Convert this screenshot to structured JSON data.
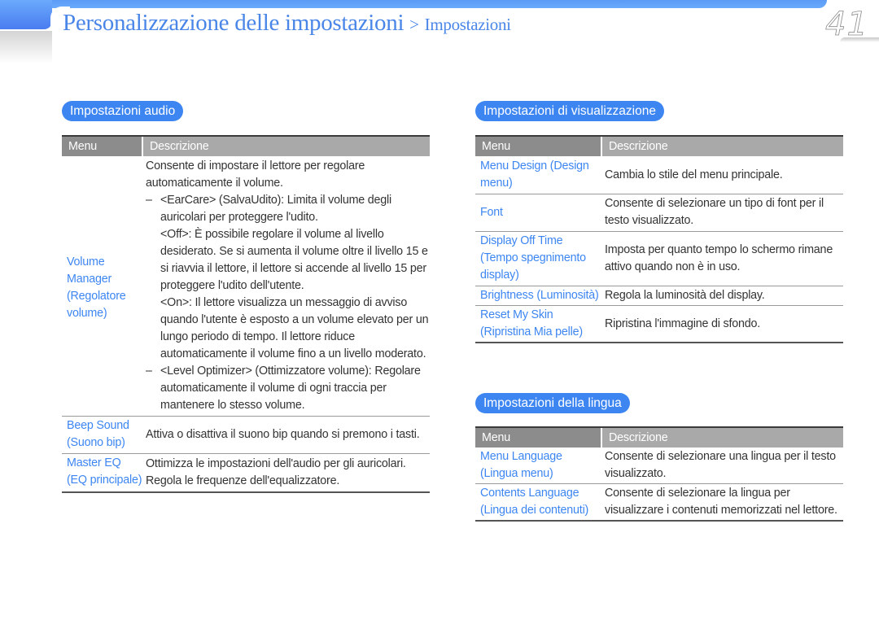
{
  "header": {
    "title_main": "Personalizzazione delle impostazioni",
    "separator": ">",
    "title_sub": "Impostazioni",
    "page_number": "41",
    "accent_color": "#3d86f2"
  },
  "audio": {
    "section_title": "Impostazioni audio",
    "columns": [
      "Menu",
      "Descrizione"
    ],
    "rows": [
      {
        "menu": "Volume Manager (Regolatore volume)",
        "intro": "Consente di impostare il lettore per regolare automaticamente il volume.",
        "dash1_title": "<EarCare> (SalvaUdito): Limita il volume degli auricolari per proteggere l'udito.",
        "dash1_off": "<Off>: È possibile regolare il volume al livello desiderato. Se si aumenta il volume oltre il livello 15 e si riavvia il lettore, il lettore si accende al livello 15 per proteggere l'udito dell'utente.",
        "dash1_on": "<On>: Il lettore visualizza un messaggio di avviso quando l'utente è esposto a un volume elevato per un lungo periodo di tempo. Il lettore riduce automaticamente il volume fino a un livello moderato.",
        "dash2": "<Level Optimizer> (Ottimizzatore volume): Regolare automaticamente il volume di ogni traccia per mantenere lo stesso volume.",
        "dash": "–"
      },
      {
        "menu": "Beep Sound (Suono bip)",
        "desc": "Attiva o disattiva il suono bip quando si premono i tasti."
      },
      {
        "menu": "Master EQ (EQ principale)",
        "desc": "Ottimizza le impostazioni dell'audio per gli auricolari. Regola le frequenze dell'equalizzatore."
      }
    ]
  },
  "display": {
    "section_title": "Impostazioni di visualizzazione",
    "columns": [
      "Menu",
      "Descrizione"
    ],
    "rows": [
      {
        "menu": "Menu Design (Design menu)",
        "desc": "Cambia lo stile del menu principale."
      },
      {
        "menu": "Font",
        "desc": "Consente di selezionare un tipo di font per il testo visualizzato."
      },
      {
        "menu": "Display Off Time (Tempo spegnimento display)",
        "desc": "Imposta per quanto tempo lo schermo rimane attivo quando non è in uso."
      },
      {
        "menu": "Brightness (Luminosità)",
        "desc": "Regola la luminosità del display."
      },
      {
        "menu": "Reset My Skin (Ripristina Mia pelle)",
        "desc": "Ripristina l'immagine di sfondo."
      }
    ]
  },
  "language": {
    "section_title": "Impostazioni della lingua",
    "columns": [
      "Menu",
      "Descrizione"
    ],
    "rows": [
      {
        "menu": "Menu Language (Lingua menu)",
        "desc": "Consente di selezionare una lingua per il testo visualizzato."
      },
      {
        "menu": "Contents Language (Lingua dei contenuti)",
        "desc": "Consente di selezionare la lingua per visualizzare i contenuti memorizzati nel lettore."
      }
    ]
  }
}
